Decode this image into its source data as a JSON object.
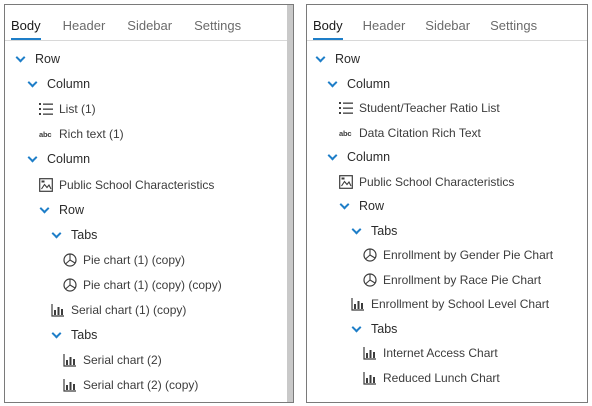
{
  "left_panel": {
    "tabs": [
      "Body",
      "Header",
      "Sidebar",
      "Settings"
    ],
    "active_tab": "Body",
    "tree": {
      "row": "Row",
      "column_1": "Column",
      "list": "List (1)",
      "rich_text": "Rich text (1)",
      "column_2": "Column",
      "public_school": "Public School Characteristics",
      "row_2": "Row",
      "tabs_1": "Tabs",
      "pie_copy": "Pie chart (1) (copy)",
      "pie_copy_copy": "Pie chart (1) (copy) (copy)",
      "serial_copy": "Serial chart (1) (copy)",
      "tabs_2": "Tabs",
      "serial_2": "Serial chart (2)",
      "serial_2_copy": "Serial chart (2) (copy)"
    }
  },
  "right_panel": {
    "tabs": [
      "Body",
      "Header",
      "Sidebar",
      "Settings"
    ],
    "active_tab": "Body",
    "tree": {
      "row": "Row",
      "column_1": "Column",
      "ratio_list": "Student/Teacher Ratio List",
      "data_citation": "Data Citation Rich Text",
      "column_2": "Column",
      "public_school": "Public School Characteristics",
      "row_2": "Row",
      "tabs_1": "Tabs",
      "gender_pie": "Enrollment by Gender Pie Chart",
      "race_pie": "Enrollment by Race Pie Chart",
      "school_level": "Enrollment by School Level Chart",
      "tabs_2": "Tabs",
      "internet": "Internet Access Chart",
      "lunch": "Reduced Lunch Chart"
    }
  },
  "icons": {
    "text_icon_glyph": "abc"
  },
  "colors": {
    "accent": "#1e7ec8",
    "border": "#7a7a7a"
  }
}
